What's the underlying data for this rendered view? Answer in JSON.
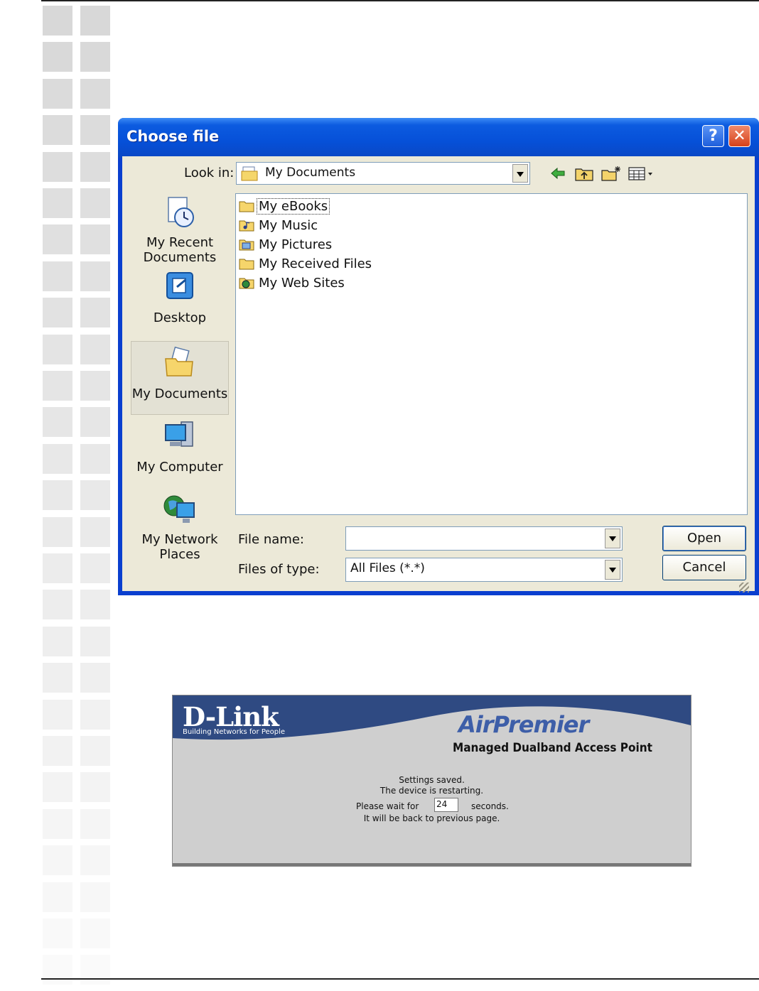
{
  "dialog": {
    "title": "Choose file",
    "look_in_label": "Look in:",
    "look_in_value": "My Documents",
    "toolbar_icons": [
      "back-arrow-icon",
      "up-folder-icon",
      "new-folder-icon",
      "view-menu-icon"
    ]
  },
  "places": [
    {
      "label_line1": "My Recent",
      "label_line2": "Documents",
      "icon": "recent-documents-icon"
    },
    {
      "label_line1": "Desktop",
      "label_line2": "",
      "icon": "desktop-icon"
    },
    {
      "label_line1": "My Documents",
      "label_line2": "",
      "icon": "my-documents-icon",
      "selected": true
    },
    {
      "label_line1": "My Computer",
      "label_line2": "",
      "icon": "my-computer-icon"
    },
    {
      "label_line1": "My Network",
      "label_line2": "Places",
      "icon": "network-places-icon"
    }
  ],
  "files": [
    {
      "name": "My eBooks",
      "icon": "folder-icon"
    },
    {
      "name": "My Music",
      "icon": "music-folder-icon"
    },
    {
      "name": "My Pictures",
      "icon": "pictures-folder-icon"
    },
    {
      "name": "My Received Files",
      "icon": "folder-icon"
    },
    {
      "name": "My Web Sites",
      "icon": "web-folder-icon"
    }
  ],
  "form": {
    "file_name_label": "File name:",
    "file_name_value": "",
    "file_type_label": "Files of type:",
    "file_type_value": "All Files (*.*)",
    "open_label": "Open",
    "cancel_label": "Cancel"
  },
  "status_panel": {
    "logo": "D-Link",
    "tagline": "Building Networks for People",
    "brand": "AirPremier",
    "subtitle": "Managed Dualband Access Point",
    "line1": "Settings saved.",
    "line2": "The device is restarting.",
    "wait_prefix": "Please wait for",
    "wait_value": "24",
    "wait_suffix": "seconds.",
    "line4": "It will be back to previous page."
  },
  "colors": {
    "title_blue": "#0650d8",
    "dialog_face": "#ece9d8",
    "dlink_navy": "#2f4a82",
    "panel_grey": "#cfcfcf"
  }
}
